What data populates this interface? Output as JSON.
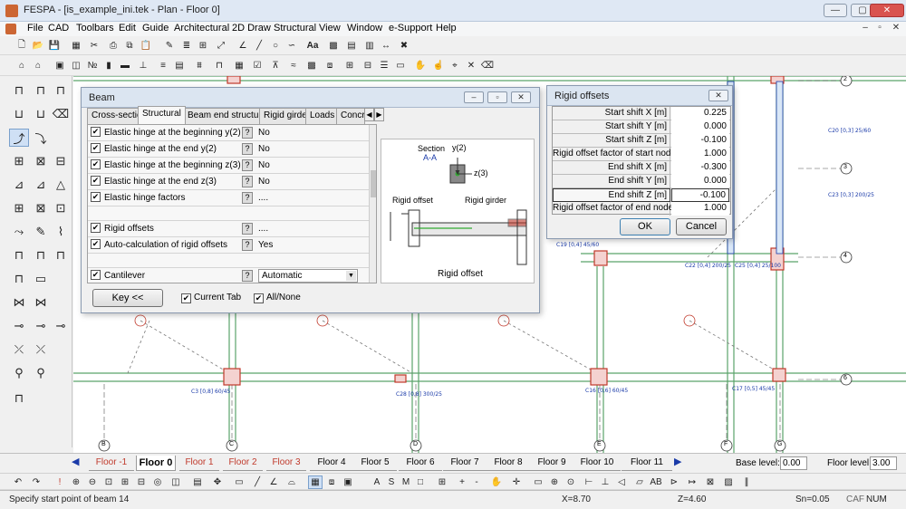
{
  "window": {
    "title": "FESPA - [is_example_ini.tek - Plan - Floor 0]",
    "controls": {
      "minimize": "—",
      "maximize": "▢",
      "close": "✕"
    }
  },
  "menu": {
    "items": [
      "File",
      "CAD",
      "Toolbars",
      "Edit",
      "Guide",
      "Architectural",
      "2D Draw",
      "Structural",
      "View",
      "Window",
      "e-Support",
      "Help"
    ]
  },
  "toolbar1": {
    "labels": [
      "Aa"
    ]
  },
  "canvas": {
    "axes": [
      "2",
      "3",
      "4",
      "5",
      "6"
    ],
    "bottom_axes": [
      "B",
      "C",
      "D",
      "E",
      "F",
      "G"
    ],
    "columns": {
      "c3": "C3 [0,8]  60/45",
      "c16": "C16 [0,6]  60/45",
      "c17": "C17 [0,5]  45/45",
      "c19": "C19 [0,4]  45/60",
      "c20": "C20 [0,3]  25/60",
      "c22": "C22 [0,4]  200/25",
      "c23": "C23 [0,3]  200/25",
      "c25": "C25 [0,4]  25/100",
      "c28": "C28 [0,8]  300/25"
    }
  },
  "beam_dialog": {
    "title": "Beam",
    "tabs": [
      "Cross-section",
      "Structural",
      "Beam end structural",
      "Rigid girder",
      "Loads",
      "Concr"
    ],
    "rows": [
      {
        "label": "Elastic hinge at the beginning y(2)",
        "value": "No"
      },
      {
        "label": "Elastic hinge at the end y(2)",
        "value": "No"
      },
      {
        "label": "Elastic hinge at the beginning z(3)",
        "value": "No"
      },
      {
        "label": "Elastic hinge at the end z(3)",
        "value": "No"
      },
      {
        "label": "Elastic hinge factors",
        "value": "...."
      },
      {
        "label": "Rigid offsets",
        "value": "...."
      },
      {
        "label": "Auto-calculation of rigid offsets",
        "value": "Yes"
      },
      {
        "label": "Cantilever",
        "value": "Automatic"
      }
    ],
    "diagram": {
      "section": "Section",
      "section_ids": "A-A",
      "y_axis": "y(2)",
      "z_axis": "z(3)",
      "rigid_offset_label": "Rigid offset",
      "rigid_girder_label": "Rigid girder",
      "caption": "Rigid offset"
    },
    "key_button": "Key <<",
    "current_tab": "Current Tab",
    "all_none": "All/None"
  },
  "rigid_dialog": {
    "title": "Rigid offsets",
    "rows": [
      {
        "label": "Start shift X [m]",
        "value": "0.225"
      },
      {
        "label": "Start shift Y [m]",
        "value": "0.000"
      },
      {
        "label": "Start shift Z [m]",
        "value": "-0.100"
      },
      {
        "label": "Rigid offset factor of start node, z",
        "value": "1.000"
      },
      {
        "label": "End shift X [m]",
        "value": "-0.300"
      },
      {
        "label": "End shift Y [m]",
        "value": "0.000"
      },
      {
        "label": "End shift Z [m]",
        "value": "-0.100"
      },
      {
        "label": "Rigid offset factor of end node, z",
        "value": "1.000"
      }
    ],
    "ok": "OK",
    "cancel": "Cancel"
  },
  "floors": {
    "tabs": [
      "Floor -1",
      "Floor 0",
      "Floor 1",
      "Floor 2",
      "Floor 3",
      "Floor 4",
      "Floor 5",
      "Floor 6",
      "Floor 7",
      "Floor 8",
      "Floor 9",
      "Floor 10",
      "Floor 11"
    ],
    "active": "Floor 0",
    "base_level_label": "Base level:",
    "base_level_value": "0.00",
    "floor_level_label": "Floor level:",
    "floor_level_value": "3.00"
  },
  "status": {
    "prompt": "Specify start point of beam 14",
    "x": "X=8.70",
    "z": "Z=4.60",
    "sn": "Sn=0.05",
    "caf": "CAF",
    "num": "NUM"
  },
  "colors": {
    "beam_green": "#5aa36a",
    "column_red": "#c0392b",
    "annot_blue": "#1a3aa8",
    "title_bg": "#dbe5f1"
  }
}
